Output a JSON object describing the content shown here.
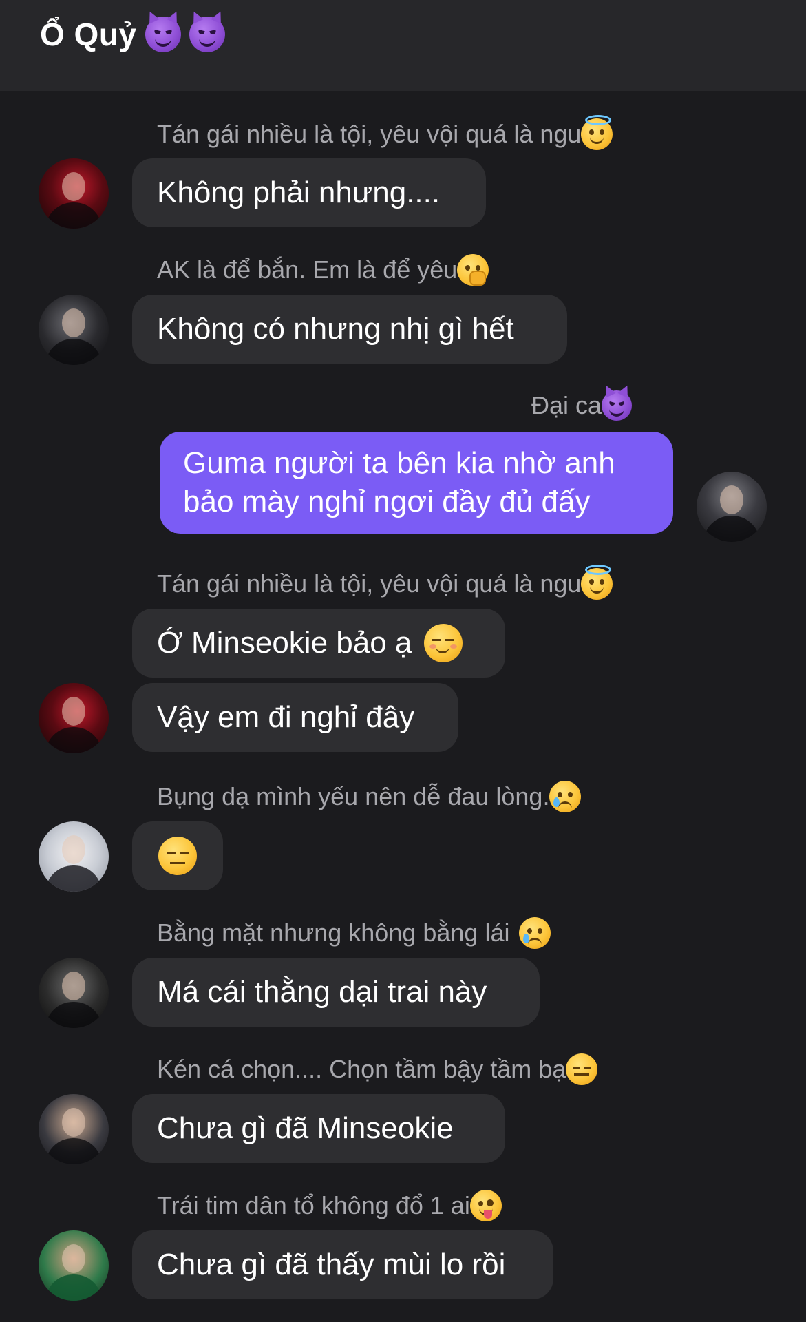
{
  "header": {
    "title": "Ổ Quỷ",
    "icons": [
      "smiling-devil-emoji",
      "smiling-devil-emoji"
    ]
  },
  "messages": [
    {
      "sender": "Tán gái nhiều là tội, yêu vội quá là ngu",
      "sender_emoji": "halo-face-emoji",
      "text": "Không phải nhưng...."
    },
    {
      "sender": "AK là để bắn. Em là để yêu",
      "sender_emoji": "hand-over-mouth-emoji",
      "text": "Không có nhưng nhị gì hết"
    },
    {
      "sender": "Đại ca",
      "sender_emoji": "smiling-devil-emoji",
      "text": "Guma người ta bên kia nhờ anh bảo mày nghỉ ngơi đầy đủ đấy",
      "mine": true
    },
    {
      "sender": "Tán gái nhiều là tội, yêu vội quá là ngu",
      "sender_emoji": "halo-face-emoji",
      "text": "Ớ Minseokie bảo ạ",
      "text_emoji": "smiling-face-emoji"
    },
    {
      "text": "Vậy em đi nghỉ đây"
    },
    {
      "sender": "Bụng dạ mình yếu nên dễ đau lòng.",
      "sender_emoji": "crying-face-emoji",
      "text_emoji": "unamused-face-emoji"
    },
    {
      "sender": "Bằng mặt nhưng không bằng lái",
      "sender_emoji": "crying-face-emoji",
      "text": "Má cái thằng dại trai này"
    },
    {
      "sender": "Kén cá chọn.... Chọn tầm bậy tầm bạ",
      "sender_emoji": "expressionless-face-emoji",
      "text": "Chưa gì đã Minseokie"
    },
    {
      "sender": "Trái tim dân tổ không đổ 1 ai",
      "sender_emoji": "zany-face-emoji",
      "text": "Chưa gì đã thấy mùi lo rồi"
    }
  ],
  "colors": {
    "background": "#1b1b1e",
    "header": "#27272a",
    "bubble_other": "#2e2e31",
    "bubble_mine": "#7b5cf5",
    "sender_text": "#a8a8ad"
  }
}
